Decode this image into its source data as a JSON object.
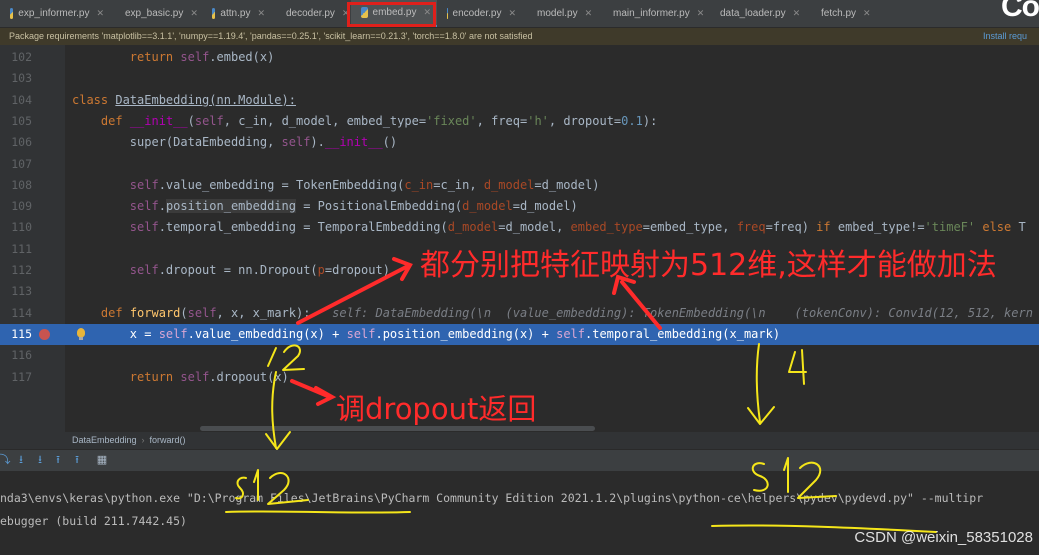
{
  "tabs": [
    {
      "label": "exp_informer.py",
      "active": false
    },
    {
      "label": "exp_basic.py",
      "active": false
    },
    {
      "label": "attn.py",
      "active": false
    },
    {
      "label": "decoder.py",
      "active": false
    },
    {
      "label": "embed.py",
      "active": true
    },
    {
      "label": "encoder.py",
      "active": false
    },
    {
      "label": "model.py",
      "active": false
    },
    {
      "label": "main_informer.py",
      "active": false
    },
    {
      "label": "data_loader.py",
      "active": false
    },
    {
      "label": "fetch.py",
      "active": false
    }
  ],
  "logo_fragment": "Co",
  "notice": {
    "text": "Package requirements 'matplotlib==3.1.1', 'numpy==1.19.4', 'pandas==0.25.1', 'scikit_learn==0.21.3', 'torch==1.8.0' are not satisfied",
    "action": "Install requ"
  },
  "editor": {
    "line_numbers": [
      "102",
      "103",
      "104",
      "105",
      "106",
      "107",
      "108",
      "109",
      "110",
      "111",
      "112",
      "113",
      "114",
      "115",
      "116",
      "117"
    ],
    "current_line": "115",
    "breakpoint_line": "115"
  },
  "breadcrumb": [
    "DataEmbedding",
    "forward()"
  ],
  "console": {
    "lines": [
      "nda3\\envs\\keras\\python.exe \"D:\\Program Files\\JetBrains\\PyCharm Community Edition 2021.1.2\\plugins\\python-ce\\helpers\\pydev\\pydevd.py\" --multipr",
      "ebugger (build 211.7442.45)"
    ]
  },
  "annotations": {
    "main_note": "都分别把特征映射为512维,这样才能做加法",
    "dropout_note": "调dropout返回",
    "hand_12": "12",
    "hand_4": "4",
    "hand_512_left": "512",
    "hand_512_right": "512"
  },
  "watermark": "CSDN @weixin_58351028",
  "colors": {
    "editor_bg": "#2b2b2b",
    "current_line": "#2f64b0",
    "keyword": "#cc7832",
    "annotation_red": "#ff2b2b",
    "handwriting_yellow": "#f5e61a"
  }
}
